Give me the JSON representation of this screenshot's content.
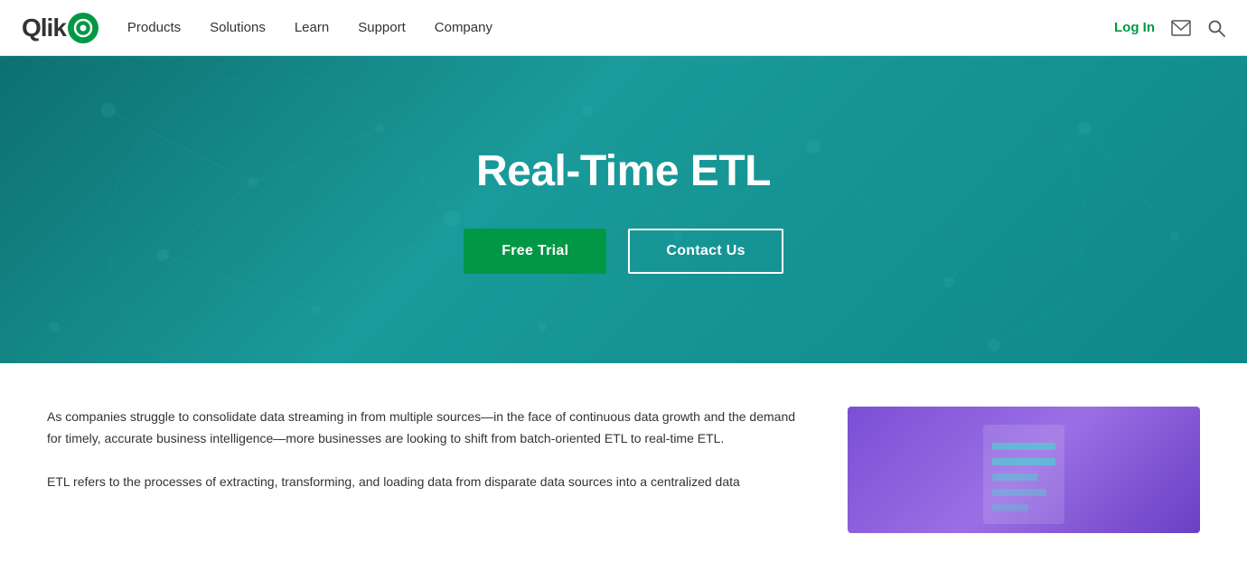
{
  "navbar": {
    "logo_text": "Qlik",
    "nav_items": [
      {
        "label": "Products",
        "id": "products"
      },
      {
        "label": "Solutions",
        "id": "solutions"
      },
      {
        "label": "Learn",
        "id": "learn"
      },
      {
        "label": "Support",
        "id": "support"
      },
      {
        "label": "Company",
        "id": "company"
      }
    ],
    "login_label": "Log In"
  },
  "hero": {
    "title": "Real-Time ETL",
    "free_trial_label": "Free Trial",
    "contact_label": "Contact Us"
  },
  "content": {
    "paragraph1": "As companies struggle to consolidate data streaming in from multiple sources—in the face of continuous data growth and the demand for timely, accurate business intelligence—more businesses are looking to shift from batch-oriented ETL to real-time ETL.",
    "paragraph2": "ETL refers to the processes of extracting, transforming, and loading data from disparate data sources into a centralized data"
  }
}
